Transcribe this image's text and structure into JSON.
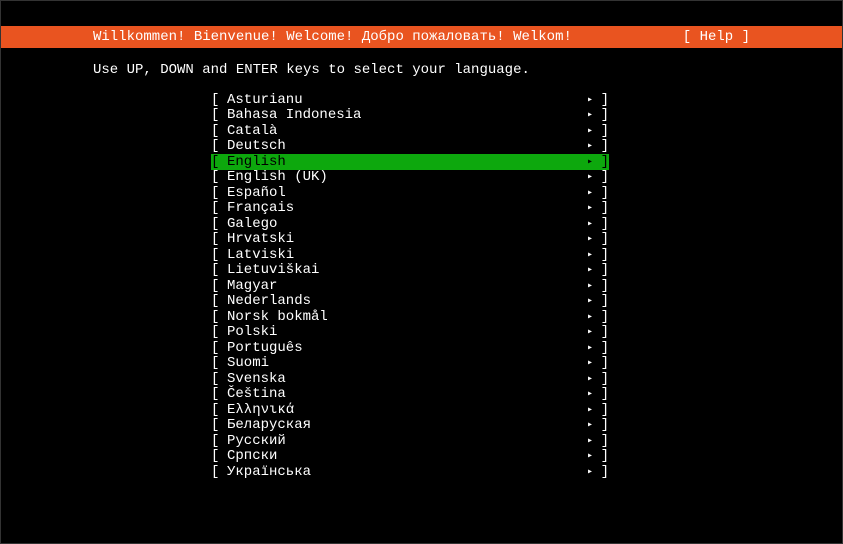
{
  "header": {
    "title": "Willkommen! Bienvenue! Welcome! Добро пожаловать! Welkom!",
    "help": "[ Help ]"
  },
  "instruction": "Use UP, DOWN and ENTER keys to select your language.",
  "brackets": {
    "open": "[ ",
    "close": " ]",
    "arrow": "▸"
  },
  "languages": [
    {
      "label": "Asturianu",
      "selected": false
    },
    {
      "label": "Bahasa Indonesia",
      "selected": false
    },
    {
      "label": "Català",
      "selected": false
    },
    {
      "label": "Deutsch",
      "selected": false
    },
    {
      "label": "English",
      "selected": true
    },
    {
      "label": "English (UK)",
      "selected": false
    },
    {
      "label": "Español",
      "selected": false
    },
    {
      "label": "Français",
      "selected": false
    },
    {
      "label": "Galego",
      "selected": false
    },
    {
      "label": "Hrvatski",
      "selected": false
    },
    {
      "label": "Latviski",
      "selected": false
    },
    {
      "label": "Lietuviškai",
      "selected": false
    },
    {
      "label": "Magyar",
      "selected": false
    },
    {
      "label": "Nederlands",
      "selected": false
    },
    {
      "label": "Norsk bokmål",
      "selected": false
    },
    {
      "label": "Polski",
      "selected": false
    },
    {
      "label": "Português",
      "selected": false
    },
    {
      "label": "Suomi",
      "selected": false
    },
    {
      "label": "Svenska",
      "selected": false
    },
    {
      "label": "Čeština",
      "selected": false
    },
    {
      "label": "Ελληνικά",
      "selected": false
    },
    {
      "label": "Беларуская",
      "selected": false
    },
    {
      "label": "Русский",
      "selected": false
    },
    {
      "label": "Српски",
      "selected": false
    },
    {
      "label": "Українська",
      "selected": false
    }
  ]
}
